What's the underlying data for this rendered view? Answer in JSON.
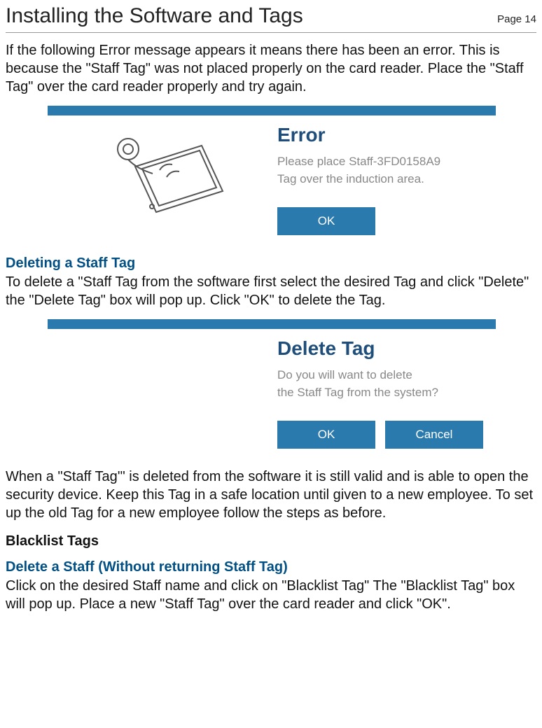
{
  "header": {
    "title": "Installing the Software and Tags",
    "page_number": "Page 14"
  },
  "para": {
    "intro": "If the following Error message appears it means there has been an error. This is because the \"Staff Tag\" was not placed properly on the card reader. Place the \"Staff Tag\" over the  card reader properly and try again.",
    "deleting_body": "To delete a \"Staff Tag from the software first select the desired Tag and click \"Delete\" the \"Delete Tag\" box will pop up. Click \"OK\" to delete the Tag.",
    "after_delete": "When a \"Staff Tag'\" is deleted from the software it is still valid and is able to open the security device. Keep this Tag in a safe location until given to a new employee. To set up the old Tag for a new employee follow the steps as before.",
    "blacklist_body": "Click on the desired Staff name and click on \"Blacklist Tag\" The \"Blacklist Tag\" box will pop up. Place a new \"Staff Tag\" over the card reader and click \"OK\"."
  },
  "headings": {
    "deleting": "Deleting a Staff Tag",
    "blacklist_tags": "Blacklist Tags",
    "delete_without": "Delete a Staff (Without returning Staff Tag)"
  },
  "dialog_error": {
    "title": "Error",
    "line1": "Please place Staff-3FD0158A9",
    "line2": "Tag over the induction area.",
    "ok": "OK"
  },
  "dialog_delete": {
    "title": "Delete Tag",
    "line1": "Do you will  want to delete",
    "line2": "the Staff Tag from the system?",
    "ok": "OK",
    "cancel": "Cancel"
  }
}
